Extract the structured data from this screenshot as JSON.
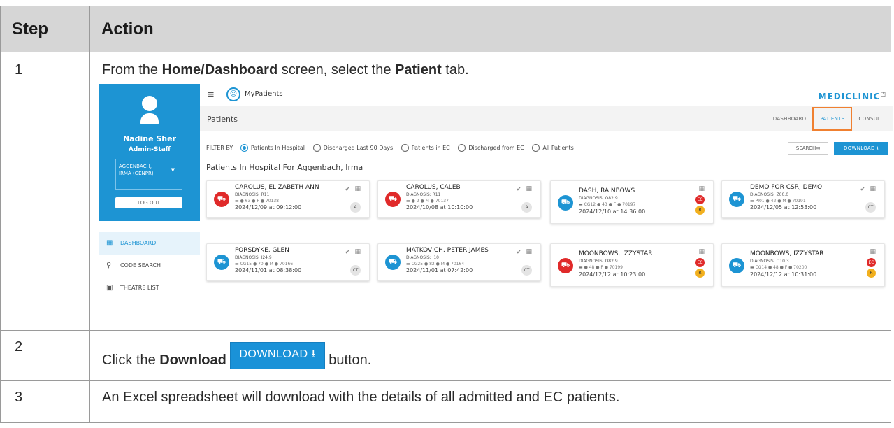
{
  "table": {
    "header": {
      "step": "Step",
      "action": "Action"
    },
    "rows": [
      {
        "step": "1",
        "text": {
          "a": "From the ",
          "b": "Home/Dashboard",
          "c": " screen, select the ",
          "d": "Patient",
          "e": " tab."
        }
      },
      {
        "step": "2",
        "text": {
          "a": "Click the ",
          "b": "Download",
          "button": "DOWNLOAD ⭳",
          "c": " button."
        }
      },
      {
        "step": "3",
        "text": "An Excel spreadsheet will download with the details of all admitted and EC patients."
      }
    ]
  },
  "app": {
    "name": "MyPatients",
    "brand": "MEDICLINIC",
    "user": {
      "name": "Nadine Sher",
      "role": "Admin-Staff",
      "selected_line1": "AGGENBACH,",
      "selected_line2": "IRMA (GENPR)",
      "logout": "LOG OUT"
    },
    "nav": [
      "DASHBOARD",
      "CODE SEARCH",
      "THEATRE LIST"
    ],
    "page_title": "Patients",
    "tabs": [
      "DASHBOARD",
      "PATIENTS",
      "CONSULT"
    ],
    "filter_label": "FILTER BY",
    "filters": [
      "Patients In Hospital",
      "Discharged Last 90 Days",
      "Patients in EC",
      "Discharged from EC",
      "All Patients"
    ],
    "search": "SEARCH⇉",
    "download": "DOWNLOAD ⭳",
    "list_title": "Patients In Hospital For Aggenbach, Irma",
    "cards": [
      {
        "name": "CAROLUS, ELIZABETH ANN",
        "diagnosis": "DIAGNOSIS: R11",
        "meta": "▬  ●  63  ●  F  ●  70138",
        "datetime": "2024/12/09 at 09:12:00",
        "badge": "A",
        "color": "#e02a2a"
      },
      {
        "name": "CAROLUS, CALEB",
        "diagnosis": "DIAGNOSIS: R11",
        "meta": "▬  ●  2  ●  M  ●  70137",
        "datetime": "2024/10/08 at 10:10:00",
        "badge": "A",
        "color": "#e02a2a"
      },
      {
        "name": "DASH, RAINBOWS",
        "diagnosis": "DIAGNOSIS: O82.9",
        "meta": "▬  CG12  ●  43  ●  F  ●  70197",
        "datetime": "2024/12/10 at 14:36:00",
        "badge1": "EC",
        "badge2": "R",
        "color": "#1d94d3"
      },
      {
        "name": "DEMO FOR CSR, DEMO",
        "diagnosis": "DIAGNOSIS: Z00.0",
        "meta": "▬  PI01  ●  42  ●  M  ●  70191",
        "datetime": "2024/12/05 at 12:53:00",
        "badge": "CT",
        "color": "#1d94d3"
      },
      {
        "name": "FORSDYKE, GLEN",
        "diagnosis": "DIAGNOSIS: I24.9",
        "meta": "▬  CG15  ●  70  ●  M  ●  70166",
        "datetime": "2024/11/01 at 08:38:00",
        "badge": "CT",
        "color": "#1d94d3"
      },
      {
        "name": "MATKOVICH, PETER JAMES",
        "diagnosis": "DIAGNOSIS: I10",
        "meta": "▬  CG25  ●  82  ●  M  ●  70164",
        "datetime": "2024/11/01 at 07:42:00",
        "badge": "CT",
        "color": "#1d94d3"
      },
      {
        "name": "MOONBOWS, IZZYSTAR",
        "diagnosis": "DIAGNOSIS: O82.9",
        "meta": "▬  ●  48  ●  F  ●  70199",
        "datetime": "2024/12/12 at 10:23:00",
        "badge1": "EC",
        "badge2": "R",
        "color": "#e02a2a"
      },
      {
        "name": "MOONBOWS, IZZYSTAR",
        "diagnosis": "DIAGNOSIS: O10.3",
        "meta": "▬  CG14  ●  48  ●  F  ●  70200",
        "datetime": "2024/12/12 at 10:31:00",
        "badge1": "EC",
        "badge2": "R",
        "color": "#1d94d3"
      }
    ]
  }
}
